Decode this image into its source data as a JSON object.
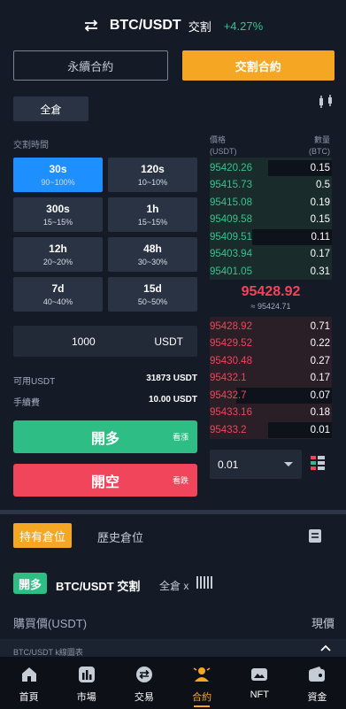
{
  "header": {
    "pair": "BTC/USDT",
    "type": "交割",
    "change": "+4.27%"
  },
  "mode_tabs": [
    {
      "label": "永續合約"
    },
    {
      "label": "交割合約"
    }
  ],
  "margin_mode": "全倉",
  "time_section_label": "交割時間",
  "time_options": [
    {
      "time": "30s",
      "range": "90~100%"
    },
    {
      "time": "120s",
      "range": "10~10%"
    },
    {
      "time": "300s",
      "range": "15~15%"
    },
    {
      "time": "1h",
      "range": "15~15%"
    },
    {
      "time": "12h",
      "range": "20~20%"
    },
    {
      "time": "48h",
      "range": "30~30%"
    },
    {
      "time": "7d",
      "range": "40~40%"
    },
    {
      "time": "15d",
      "range": "50~50%"
    }
  ],
  "amount": {
    "value": "1000",
    "unit": "USDT"
  },
  "available": {
    "label": "可用USDT",
    "value": "31873 USDT"
  },
  "fee": {
    "label": "手續費",
    "value": "10.00 USDT"
  },
  "buttons": {
    "long": {
      "label": "開多",
      "hint": "看漲"
    },
    "short": {
      "label": "開空",
      "hint": "看跌"
    }
  },
  "orderbook": {
    "price_header": "價格",
    "price_unit": "(USDT)",
    "qty_header": "數量",
    "qty_unit": "(BTC)",
    "bids": [
      {
        "price": "95420.26",
        "qty": "0.15",
        "depth": 0.52
      },
      {
        "price": "95415.73",
        "qty": "0.5",
        "depth": 0.0
      },
      {
        "price": "95415.08",
        "qty": "0.19",
        "depth": 0.0
      },
      {
        "price": "95409.58",
        "qty": "0.15",
        "depth": 0.0
      },
      {
        "price": "95409.51",
        "qty": "0.11",
        "depth": 0.65
      },
      {
        "price": "95403.94",
        "qty": "0.17",
        "depth": 0.0
      },
      {
        "price": "95401.05",
        "qty": "0.31",
        "depth": 0.0
      }
    ],
    "last_price": "95428.92",
    "mark_price": "≈ 95424.71",
    "asks": [
      {
        "price": "95428.92",
        "qty": "0.71",
        "depth": 0.0
      },
      {
        "price": "95429.52",
        "qty": "0.22",
        "depth": 0.0
      },
      {
        "price": "95430.48",
        "qty": "0.27",
        "depth": 0.0
      },
      {
        "price": "95432.1",
        "qty": "0.17",
        "depth": 0.0
      },
      {
        "price": "95432.7",
        "qty": "0.07",
        "depth": 0.78
      },
      {
        "price": "95433.16",
        "qty": "0.18",
        "depth": 0.0
      },
      {
        "price": "95433.2",
        "qty": "0.01",
        "depth": 0.52
      }
    ],
    "step": "0.01"
  },
  "positions": {
    "tab_active": "持有倉位",
    "tab_history": "歷史倉位",
    "side": "開多",
    "pair": "BTC/USDT 交割",
    "meta": "全倉 x",
    "buy_price_label": "購買價(USDT)",
    "current_price_label": "現價",
    "kline_label": "BTC/USDT k線圖表"
  },
  "nav": [
    {
      "label": "首頁",
      "icon": "home-icon"
    },
    {
      "label": "市場",
      "icon": "market-icon"
    },
    {
      "label": "交易",
      "icon": "trade-icon"
    },
    {
      "label": "合約",
      "icon": "contract-icon"
    },
    {
      "label": "NFT",
      "icon": "nft-icon"
    },
    {
      "label": "資金",
      "icon": "wallet-icon"
    }
  ],
  "colors": {
    "accent": "#f5a623",
    "green": "#2ebd85",
    "red": "#f0455a",
    "blue": "#1e8fff",
    "background": "#141a26"
  }
}
